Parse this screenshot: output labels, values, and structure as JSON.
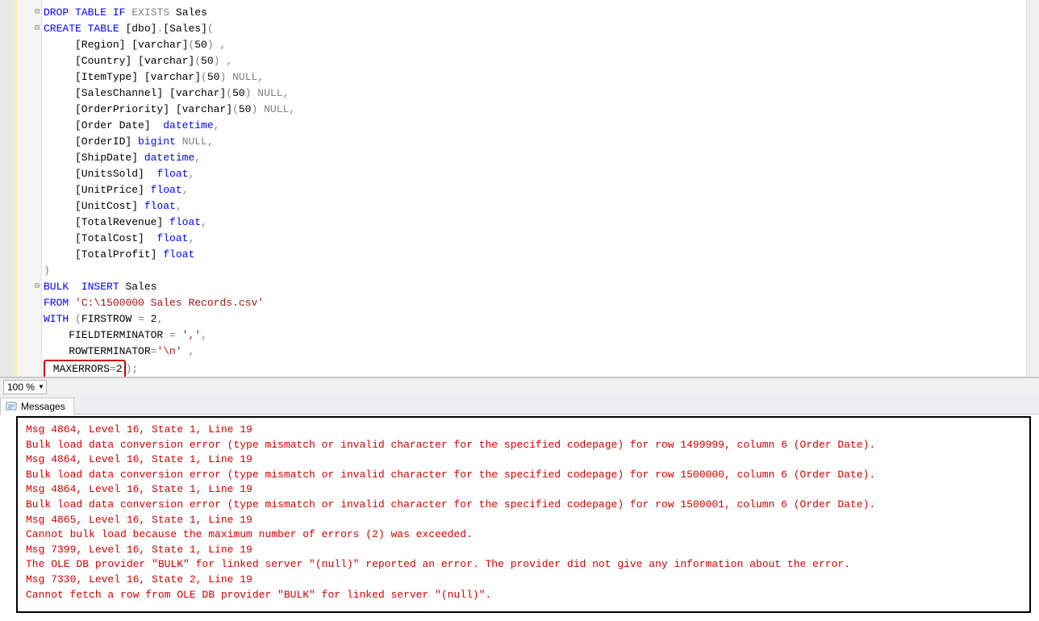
{
  "code": {
    "lines": [
      {
        "raw": "DROP TABLE IF EXISTS Sales",
        "fold": true,
        "tokens": [
          [
            "kw",
            "DROP"
          ],
          [
            "plain",
            " "
          ],
          [
            "kw",
            "TABLE"
          ],
          [
            "plain",
            " "
          ],
          [
            "kw",
            "IF"
          ],
          [
            "plain",
            " "
          ],
          [
            "gray",
            "EXISTS"
          ],
          [
            "plain",
            " Sales"
          ]
        ]
      },
      {
        "raw": "CREATE TABLE [dbo].[Sales](",
        "fold": true,
        "tokens": [
          [
            "kw",
            "CREATE"
          ],
          [
            "plain",
            " "
          ],
          [
            "kw",
            "TABLE"
          ],
          [
            "plain",
            " [dbo]"
          ],
          [
            "gray",
            "."
          ],
          [
            "plain",
            "[Sales]"
          ],
          [
            "gray",
            "("
          ]
        ]
      },
      {
        "raw": "     [Region] [varchar](50) ,",
        "tokens": [
          [
            "plain",
            "     [Region] [varchar]"
          ],
          [
            "gray",
            "("
          ],
          [
            "plain",
            "50"
          ],
          [
            "gray",
            ")"
          ],
          [
            "plain",
            " "
          ],
          [
            "gray",
            ","
          ]
        ]
      },
      {
        "raw": "     [Country] [varchar](50) ,",
        "tokens": [
          [
            "plain",
            "     [Country] [varchar]"
          ],
          [
            "gray",
            "("
          ],
          [
            "plain",
            "50"
          ],
          [
            "gray",
            ")"
          ],
          [
            "plain",
            " "
          ],
          [
            "gray",
            ","
          ]
        ]
      },
      {
        "raw": "     [ItemType] [varchar](50) NULL,",
        "tokens": [
          [
            "plain",
            "     [ItemType] [varchar]"
          ],
          [
            "gray",
            "("
          ],
          [
            "plain",
            "50"
          ],
          [
            "gray",
            ")"
          ],
          [
            "plain",
            " "
          ],
          [
            "gray",
            "NULL,"
          ]
        ]
      },
      {
        "raw": "     [SalesChannel] [varchar](50) NULL,",
        "tokens": [
          [
            "plain",
            "     [SalesChannel] [varchar]"
          ],
          [
            "gray",
            "("
          ],
          [
            "plain",
            "50"
          ],
          [
            "gray",
            ")"
          ],
          [
            "plain",
            " "
          ],
          [
            "gray",
            "NULL,"
          ]
        ]
      },
      {
        "raw": "     [OrderPriority] [varchar](50) NULL,",
        "tokens": [
          [
            "plain",
            "     [OrderPriority] [varchar]"
          ],
          [
            "gray",
            "("
          ],
          [
            "plain",
            "50"
          ],
          [
            "gray",
            ")"
          ],
          [
            "plain",
            " "
          ],
          [
            "gray",
            "NULL,"
          ]
        ]
      },
      {
        "raw": "     [Order Date]  datetime,",
        "tokens": [
          [
            "plain",
            "     [Order Date]  "
          ],
          [
            "kw",
            "datetime"
          ],
          [
            "gray",
            ","
          ]
        ]
      },
      {
        "raw": "     [OrderID] bigint NULL,",
        "tokens": [
          [
            "plain",
            "     [OrderID] "
          ],
          [
            "kw",
            "bigint"
          ],
          [
            "plain",
            " "
          ],
          [
            "gray",
            "NULL,"
          ]
        ]
      },
      {
        "raw": "     [ShipDate] datetime,",
        "tokens": [
          [
            "plain",
            "     [ShipDate] "
          ],
          [
            "kw",
            "datetime"
          ],
          [
            "gray",
            ","
          ]
        ]
      },
      {
        "raw": "     [UnitsSold]  float,",
        "tokens": [
          [
            "plain",
            "     [UnitsSold]  "
          ],
          [
            "kw",
            "float"
          ],
          [
            "gray",
            ","
          ]
        ]
      },
      {
        "raw": "     [UnitPrice] float,",
        "tokens": [
          [
            "plain",
            "     [UnitPrice] "
          ],
          [
            "kw",
            "float"
          ],
          [
            "gray",
            ","
          ]
        ]
      },
      {
        "raw": "     [UnitCost] float,",
        "tokens": [
          [
            "plain",
            "     [UnitCost] "
          ],
          [
            "kw",
            "float"
          ],
          [
            "gray",
            ","
          ]
        ]
      },
      {
        "raw": "     [TotalRevenue] float,",
        "tokens": [
          [
            "plain",
            "     [TotalRevenue] "
          ],
          [
            "kw",
            "float"
          ],
          [
            "gray",
            ","
          ]
        ]
      },
      {
        "raw": "     [TotalCost]  float,",
        "tokens": [
          [
            "plain",
            "     [TotalCost]  "
          ],
          [
            "kw",
            "float"
          ],
          [
            "gray",
            ","
          ]
        ]
      },
      {
        "raw": "     [TotalProfit] float",
        "tokens": [
          [
            "plain",
            "     [TotalProfit] "
          ],
          [
            "kw",
            "float"
          ]
        ]
      },
      {
        "raw": ")",
        "tokens": [
          [
            "gray",
            ")"
          ]
        ]
      },
      {
        "raw": "BULK INSERT Sales",
        "fold": true,
        "tokens": [
          [
            "kw",
            "BULK"
          ],
          [
            "plain",
            "  "
          ],
          [
            "kw",
            "INSERT"
          ],
          [
            "plain",
            " Sales"
          ]
        ]
      },
      {
        "raw": "FROM 'C:\\1500000 Sales Records.csv'",
        "tokens": [
          [
            "kw",
            "FROM"
          ],
          [
            "plain",
            " "
          ],
          [
            "str",
            "'C:\\1500000 Sales Records.csv'"
          ]
        ]
      },
      {
        "raw": "WITH (FIRSTROW = 2,",
        "tokens": [
          [
            "kw",
            "WITH"
          ],
          [
            "plain",
            " "
          ],
          [
            "gray",
            "("
          ],
          [
            "plain",
            "FIRSTROW "
          ],
          [
            "gray",
            "="
          ],
          [
            "plain",
            " 2"
          ],
          [
            "gray",
            ","
          ]
        ]
      },
      {
        "raw": "    FIELDTERMINATOR = ',',",
        "tokens": [
          [
            "plain",
            "    FIELDTERMINATOR "
          ],
          [
            "gray",
            "="
          ],
          [
            "plain",
            " "
          ],
          [
            "str",
            "','"
          ],
          [
            "gray",
            ","
          ]
        ]
      },
      {
        "raw": "    ROWTERMINATOR='\\n' ,",
        "tokens": [
          [
            "plain",
            "    ROWTERMINATOR"
          ],
          [
            "gray",
            "="
          ],
          [
            "str",
            "'\\n'"
          ],
          [
            "plain",
            " "
          ],
          [
            "gray",
            ","
          ]
        ]
      },
      {
        "raw": "    MAXERRORS=2);",
        "highlight": "    MAXERRORS=2",
        "tail": ");",
        "tokens": []
      }
    ]
  },
  "zoom": {
    "value": "100 %"
  },
  "messages_tab": {
    "label": "Messages"
  },
  "messages": [
    "Msg 4864, Level 16, State 1, Line 19",
    "Bulk load data conversion error (type mismatch or invalid character for the specified codepage) for row 1499999, column 6 (Order Date).",
    "Msg 4864, Level 16, State 1, Line 19",
    "Bulk load data conversion error (type mismatch or invalid character for the specified codepage) for row 1500000, column 6 (Order Date).",
    "Msg 4864, Level 16, State 1, Line 19",
    "Bulk load data conversion error (type mismatch or invalid character for the specified codepage) for row 1500001, column 6 (Order Date).",
    "Msg 4865, Level 16, State 1, Line 19",
    "Cannot bulk load because the maximum number of errors (2) was exceeded.",
    "Msg 7399, Level 16, State 1, Line 19",
    "The OLE DB provider \"BULK\" for linked server \"(null)\" reported an error. The provider did not give any information about the error.",
    "Msg 7330, Level 16, State 2, Line 19",
    "Cannot fetch a row from OLE DB provider \"BULK\" for linked server \"(null)\"."
  ]
}
